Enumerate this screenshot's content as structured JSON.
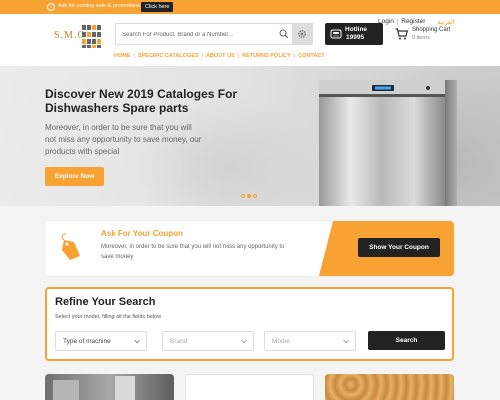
{
  "top_bar": {
    "promo_text": "Ask for coming sale & promotions",
    "click_here": "Click here"
  },
  "header": {
    "logo_text": "S.M.C",
    "search_placeholder": "Search For Product, Brand or a Number...",
    "hotline_label": "Hotline",
    "hotline_number": "19995",
    "login": "Login",
    "separator": "|",
    "register": "Register",
    "language": "العربية",
    "cart_title": "Shopping Cart",
    "cart_items": "0 items"
  },
  "nav": {
    "items": [
      "HOME",
      "SPECIFIC CATALOGES",
      "ABOUT US",
      "RETURNS POLICY",
      "CONTACT"
    ]
  },
  "hero": {
    "title": "Discover New 2019 Cataloges For Dishwashers Spare parts",
    "description": "Moreover, in order to be sure that you will not miss any opportunity to save money, our products with special",
    "button": "Explore Now",
    "slides": 3,
    "active_slide": 2
  },
  "coupon": {
    "title": "Ask For Your Coupon",
    "description": "Moreover, in order to be sure that you will not miss any opportunity to save money",
    "button": "Show Your Coupon"
  },
  "refine": {
    "title": "Refine Your Search",
    "subtitle": "Select your model, filling all the fields below",
    "machine_select": "Type of machine",
    "brand_select": "Brand",
    "model_select": "Model",
    "search_button": "Search"
  },
  "colors": {
    "accent": "#f7a233",
    "dark": "#222222"
  }
}
